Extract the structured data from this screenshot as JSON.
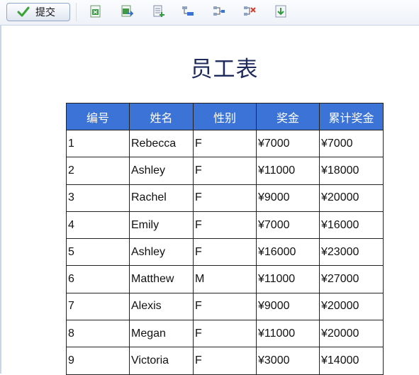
{
  "toolbar": {
    "submit_label": "提交",
    "icons": [
      "excel-export-icon",
      "excel-import-icon",
      "add-row-icon",
      "insert-row-icon",
      "indent-row-icon",
      "delete-row-icon",
      "download-icon"
    ]
  },
  "report": {
    "title": "员工表",
    "columns": [
      "编号",
      "姓名",
      "性别",
      "奖金",
      "累计奖金"
    ],
    "rows": [
      [
        "1",
        "Rebecca",
        "F",
        "¥7000",
        "¥7000"
      ],
      [
        "2",
        "Ashley",
        "F",
        "¥11000",
        "¥18000"
      ],
      [
        "3",
        "Rachel",
        "F",
        "¥9000",
        "¥20000"
      ],
      [
        "4",
        "Emily",
        "F",
        "¥7000",
        "¥16000"
      ],
      [
        "5",
        "Ashley",
        "F",
        "¥16000",
        "¥23000"
      ],
      [
        "6",
        "Matthew",
        "M",
        "¥11000",
        "¥27000"
      ],
      [
        "7",
        "Alexis",
        "F",
        "¥9000",
        "¥20000"
      ],
      [
        "8",
        "Megan",
        "F",
        "¥11000",
        "¥20000"
      ],
      [
        "9",
        "Victoria",
        "F",
        "¥3000",
        "¥14000"
      ]
    ]
  },
  "colors": {
    "header_bg": "#3b73d6",
    "title": "#1f2a5c"
  }
}
